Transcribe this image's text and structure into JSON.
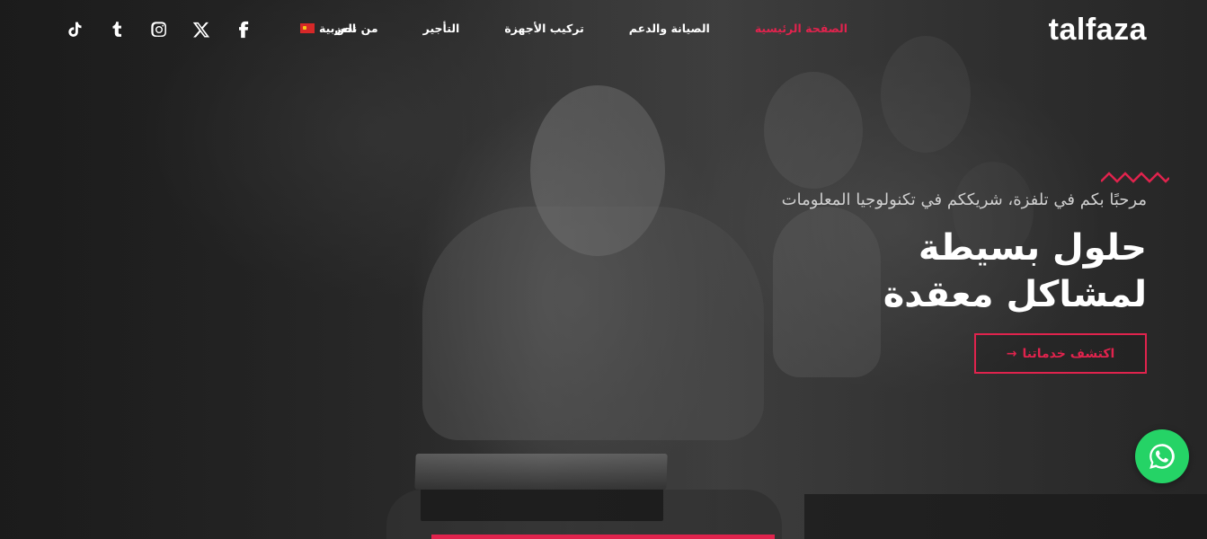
{
  "header": {
    "logo": "talfaza",
    "nav": [
      {
        "label": "الصفحة الرئيسية",
        "active": true
      },
      {
        "label": "الصيانة والدعم",
        "active": false
      },
      {
        "label": "تركيب الأجهزة",
        "active": false
      },
      {
        "label": "التأجير",
        "active": false
      },
      {
        "label": "من نحن",
        "active": false
      }
    ],
    "language": {
      "label": "العربية",
      "flag_icon": "flag-icon"
    },
    "social": [
      "facebook-icon",
      "x-icon",
      "instagram-icon",
      "tumblr-icon",
      "tiktok-icon"
    ]
  },
  "hero": {
    "tagline": "مرحبًا بكم في تلفزة، شريككم في تكنولوجيا المعلومات",
    "headline_line1": "حلول بسيطة",
    "headline_line2": "لمشاكل معقدة",
    "cta_label": "اكتشف خدماتنا",
    "cta_arrow": "→"
  },
  "floating": {
    "whatsapp_icon": "whatsapp-icon"
  },
  "colors": {
    "accent": "#e0234d",
    "whatsapp": "#25d366",
    "background": "#2b2b2b"
  }
}
